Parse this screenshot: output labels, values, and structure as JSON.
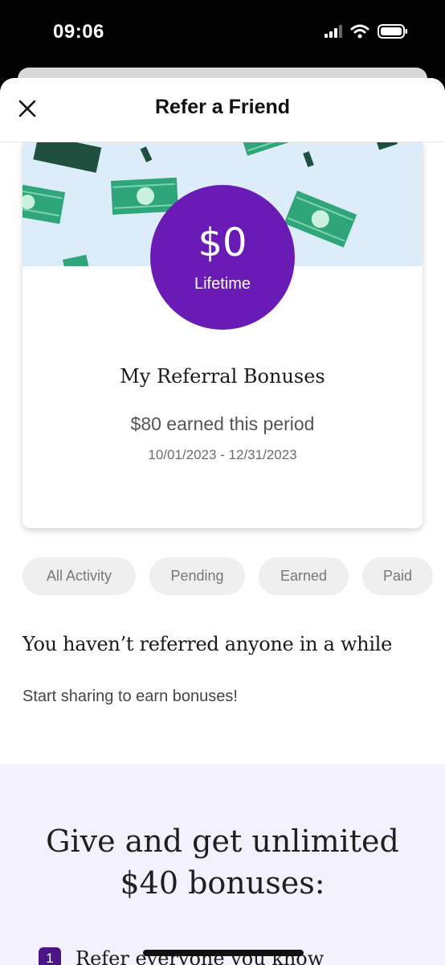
{
  "status_bar": {
    "time": "09:06"
  },
  "header": {
    "title": "Refer a Friend"
  },
  "summary": {
    "lifetime_amount": "$0",
    "lifetime_label": "Lifetime",
    "heading": "My Referral Bonuses",
    "earned_text": "$80 earned this period",
    "date_range": "10/01/2023 - 12/31/2023"
  },
  "filters": [
    "All Activity",
    "Pending",
    "Earned",
    "Paid"
  ],
  "empty_state": {
    "heading": "You haven’t referred anyone in a while",
    "subtext": "Start sharing to earn bonuses!"
  },
  "promo": {
    "title_line1": "Give and get unlimited",
    "title_line2": "$40 bonuses:",
    "steps": [
      {
        "number": "1",
        "text": "Refer everyone you know"
      }
    ]
  },
  "colors": {
    "brand_purple": "#6a1bb6",
    "banner_blue": "#dcecf9",
    "money_green": "#2fa57a",
    "promo_bg": "#f3f1fb"
  },
  "icons": [
    "signal-icon",
    "wifi-icon",
    "battery-icon",
    "close-icon"
  ]
}
